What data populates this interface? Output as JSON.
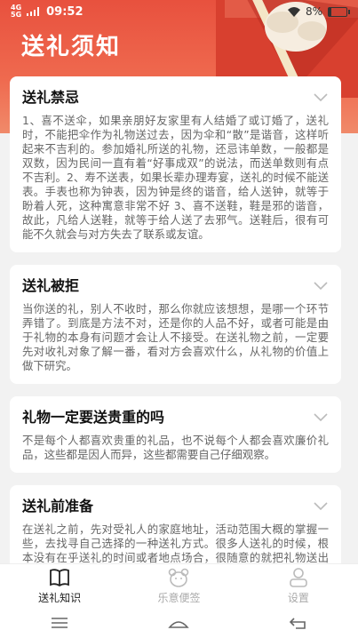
{
  "status_bar": {
    "signal1": "4G",
    "signal2": "5G",
    "time": "09:52",
    "battery": "8%"
  },
  "header": {
    "title": "送礼须知"
  },
  "cards": [
    {
      "title": "送礼禁忌",
      "body": "1、喜不送伞，如果亲朋好友家里有人结婚了或订婚了，送礼时，不能把伞作为礼物送过去，因为伞和“散”是谐音，这样听起来不吉利的。参加婚礼所送的礼物，还忌讳单数，一般都是双数，因为民间一直有着“好事成双”的说法，而送单数则有点不吉利。2、寿不送表，如果长辈办理寿宴，送礼的时候不能送表。手表也称为钟表，因为钟是终的谐音，给人送钟，就等于盼着人死，这种寓意非常不好 3、喜不送鞋，鞋是邪的谐音，故此，凡给人送鞋，就等于给人送了去邪气。送鞋后，很有可能不久就会与对方失去了联系或友谊。"
    },
    {
      "title": "送礼被拒",
      "body": "当你送的礼，别人不收时，那么你就应该想想，是哪一个环节弄错了。到底是方法不对，还是你的人品不好，或者可能是由于礼物的本身有问题才会让人不接受。在送礼物之前，一定要先对收礼对象了解一番，看对方会喜欢什么，从礼物的价值上做下研究。"
    },
    {
      "title": "礼物一定要送贵重的吗",
      "body": "不是每个人都喜欢贵重的礼品，也不说每个人都会喜欢廉价礼品，这些都是因人而异，这些都需要自己仔细观察。"
    },
    {
      "title": "送礼前准备",
      "body": "在送礼之前，先对受礼人的家庭地址，活动范围大概的掌握一些，去找寻自己选择的一种送礼方式。很多人送礼的时候，根本没有在乎送礼的时间或者地点场合，很随意的就把礼物送出去了。不但没有达到送礼"
    }
  ],
  "tabs": [
    {
      "label": "送礼知识",
      "icon": "book-icon",
      "active": true
    },
    {
      "label": "乐意便签",
      "icon": "bear-icon",
      "active": false
    },
    {
      "label": "设置",
      "icon": "user-icon",
      "active": false
    }
  ],
  "colors": {
    "header": "#e8513e",
    "background": "#f2f2f2",
    "card": "#ffffff"
  }
}
